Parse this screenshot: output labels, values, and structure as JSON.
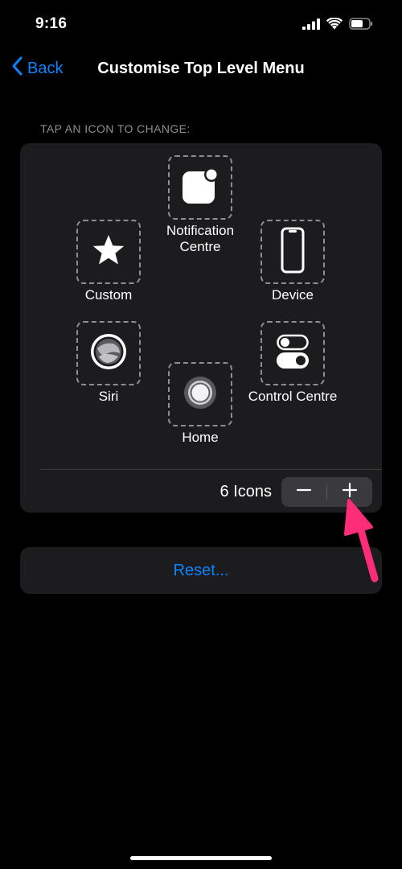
{
  "status_bar": {
    "time": "9:16"
  },
  "nav": {
    "back_label": "Back",
    "title": "Customise Top Level Menu"
  },
  "section_header": "TAP AN ICON TO CHANGE:",
  "menu_items": [
    {
      "label": "Notification Centre",
      "icon": "notification-centre-icon"
    },
    {
      "label": "Custom",
      "icon": "star-icon"
    },
    {
      "label": "Device",
      "icon": "device-icon"
    },
    {
      "label": "Siri",
      "icon": "siri-icon"
    },
    {
      "label": "Home",
      "icon": "home-button-icon"
    },
    {
      "label": "Control Centre",
      "icon": "control-centre-icon"
    }
  ],
  "icon_count": {
    "label": "6 Icons"
  },
  "stepper": {
    "minus": "−",
    "plus": "+"
  },
  "reset": {
    "label": "Reset..."
  },
  "colors": {
    "accent": "#0a84ff",
    "annotation": "#ff2d78",
    "card": "#1c1c1e",
    "background": "#000000"
  }
}
